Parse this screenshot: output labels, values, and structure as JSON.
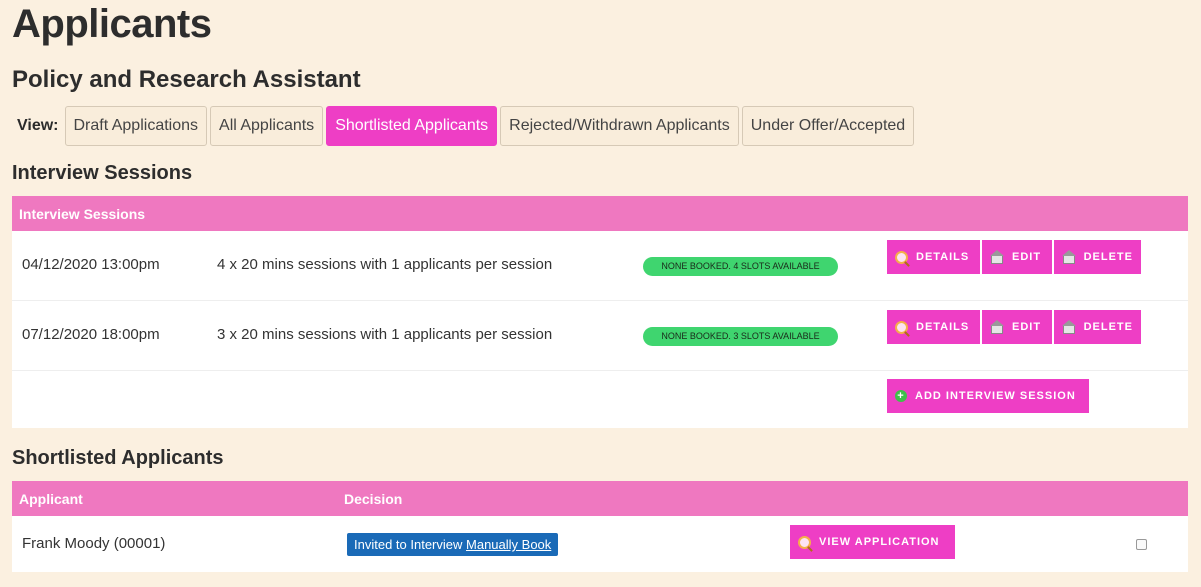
{
  "page": {
    "title": "Applicants",
    "job_title": "Policy and Research Assistant"
  },
  "view": {
    "label": "View:",
    "tabs": [
      {
        "label": "Draft Applications",
        "active": false
      },
      {
        "label": "All Applicants",
        "active": false
      },
      {
        "label": "Shortlisted Applicants",
        "active": true
      },
      {
        "label": "Rejected/Withdrawn Applicants",
        "active": false
      },
      {
        "label": "Under Offer/Accepted",
        "active": false
      }
    ]
  },
  "interview_sessions": {
    "section_title": "Interview Sessions",
    "table_header": "Interview Sessions",
    "sessions": [
      {
        "datetime": "04/12/2020 13:00pm",
        "description": "4 x 20 mins sessions with 1 applicants per session",
        "status": "NONE BOOKED. 4 SLOTS AVAILABLE"
      },
      {
        "datetime": "07/12/2020 18:00pm",
        "description": "3 x 20 mins sessions with 1 applicants per session",
        "status": "NONE BOOKED. 3 SLOTS AVAILABLE"
      }
    ],
    "buttons": {
      "details": "DETAILS",
      "edit": "EDIT",
      "delete": "DELETE",
      "add": "ADD INTERVIEW SESSION"
    }
  },
  "shortlisted": {
    "section_title": "Shortlisted Applicants",
    "columns": {
      "applicant": "Applicant",
      "decision": "Decision"
    },
    "rows": [
      {
        "applicant": "Frank Moody (00001)",
        "decision_text": "Invited to Interview",
        "decision_link": "Manually Book",
        "button": "VIEW APPLICATION",
        "checked": false
      }
    ]
  },
  "colors": {
    "accent": "#ee3ec5",
    "header": "#ef78c0",
    "badge": "#3fd56f",
    "decision": "#1a6ab7",
    "background": "#fbf0e0"
  }
}
